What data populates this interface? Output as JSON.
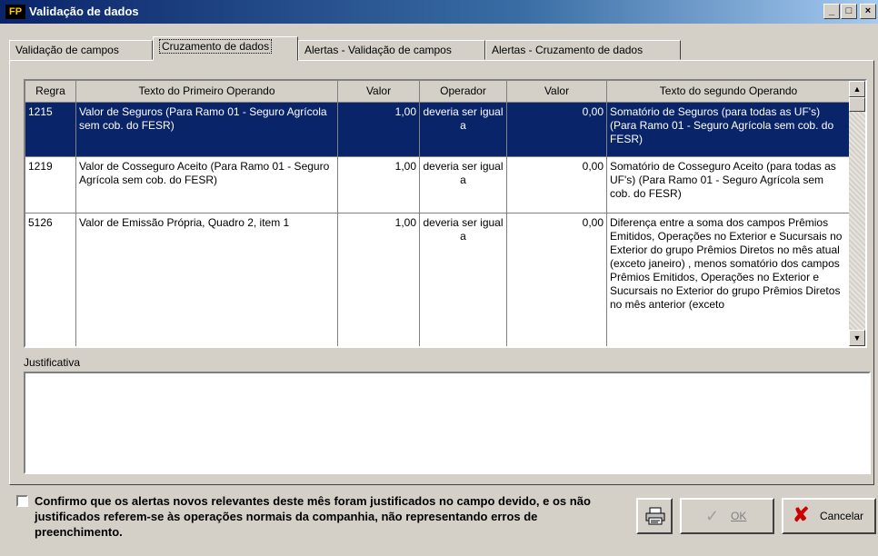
{
  "window": {
    "title": "Validação de dados",
    "icon_text": "FP",
    "minimize": "_",
    "maximize": "□",
    "close": "×"
  },
  "tabs": [
    {
      "label": "Validação de campos",
      "active": false
    },
    {
      "label": "Cruzamento de dados",
      "active": true
    },
    {
      "label": "Alertas - Validação de campos",
      "active": false
    },
    {
      "label": "Alertas - Cruzamento de dados",
      "active": false
    }
  ],
  "grid": {
    "columns": [
      "Regra",
      "Texto do Primeiro Operando",
      "Valor",
      "Operador",
      "Valor",
      "Texto do segundo Operando"
    ],
    "rows": [
      {
        "regra": "1215",
        "texto1": "Valor de Seguros (Para Ramo 01 - Seguro Agrícola sem cob. do FESR)",
        "valor1": "1,00",
        "operador": "deveria ser igual a",
        "valor2": "0,00",
        "texto2": "Somatório de Seguros (para todas as UF's) (Para Ramo 01 - Seguro Agrícola sem cob. do FESR)",
        "selected": true
      },
      {
        "regra": "1219",
        "texto1": "Valor de Cosseguro Aceito (Para Ramo 01 - Seguro Agrícola sem cob. do FESR)",
        "valor1": "1,00",
        "operador": "deveria ser igual a",
        "valor2": "0,00",
        "texto2": "Somatório de Cosseguro Aceito (para todas as UF's) (Para Ramo 01 - Seguro Agrícola sem cob. do FESR)",
        "selected": false
      },
      {
        "regra": "5126",
        "texto1": "Valor de Emissão Própria, Quadro 2, item 1",
        "valor1": "1,00",
        "operador": "deveria ser igual a",
        "valor2": "0,00",
        "texto2": "Diferença entre a soma dos campos Prêmios Emitidos, Operações no Exterior e Sucursais no Exterior do grupo Prêmios Diretos no mês atual (exceto janeiro) , menos somatório dos campos Prêmios Emitidos, Operações no Exterior e Sucursais no Exterior do grupo Prêmios Diretos no mês anterior (exceto",
        "selected": false
      }
    ]
  },
  "justificativa": {
    "label": "Justificativa",
    "value": ""
  },
  "confirm": {
    "checked": false,
    "text": "Confirmo que os alertas novos relevantes deste mês foram justificados no campo devido, e os não justificados referem-se às operações normais da companhia, não representando erros de preenchimento."
  },
  "buttons": {
    "print_icon": "printer-icon",
    "ok_label": "OK",
    "ok_enabled": false,
    "cancel_label": "Cancelar"
  },
  "colors": {
    "selection": "#0a246a",
    "cancel_x": "#cc0000"
  }
}
